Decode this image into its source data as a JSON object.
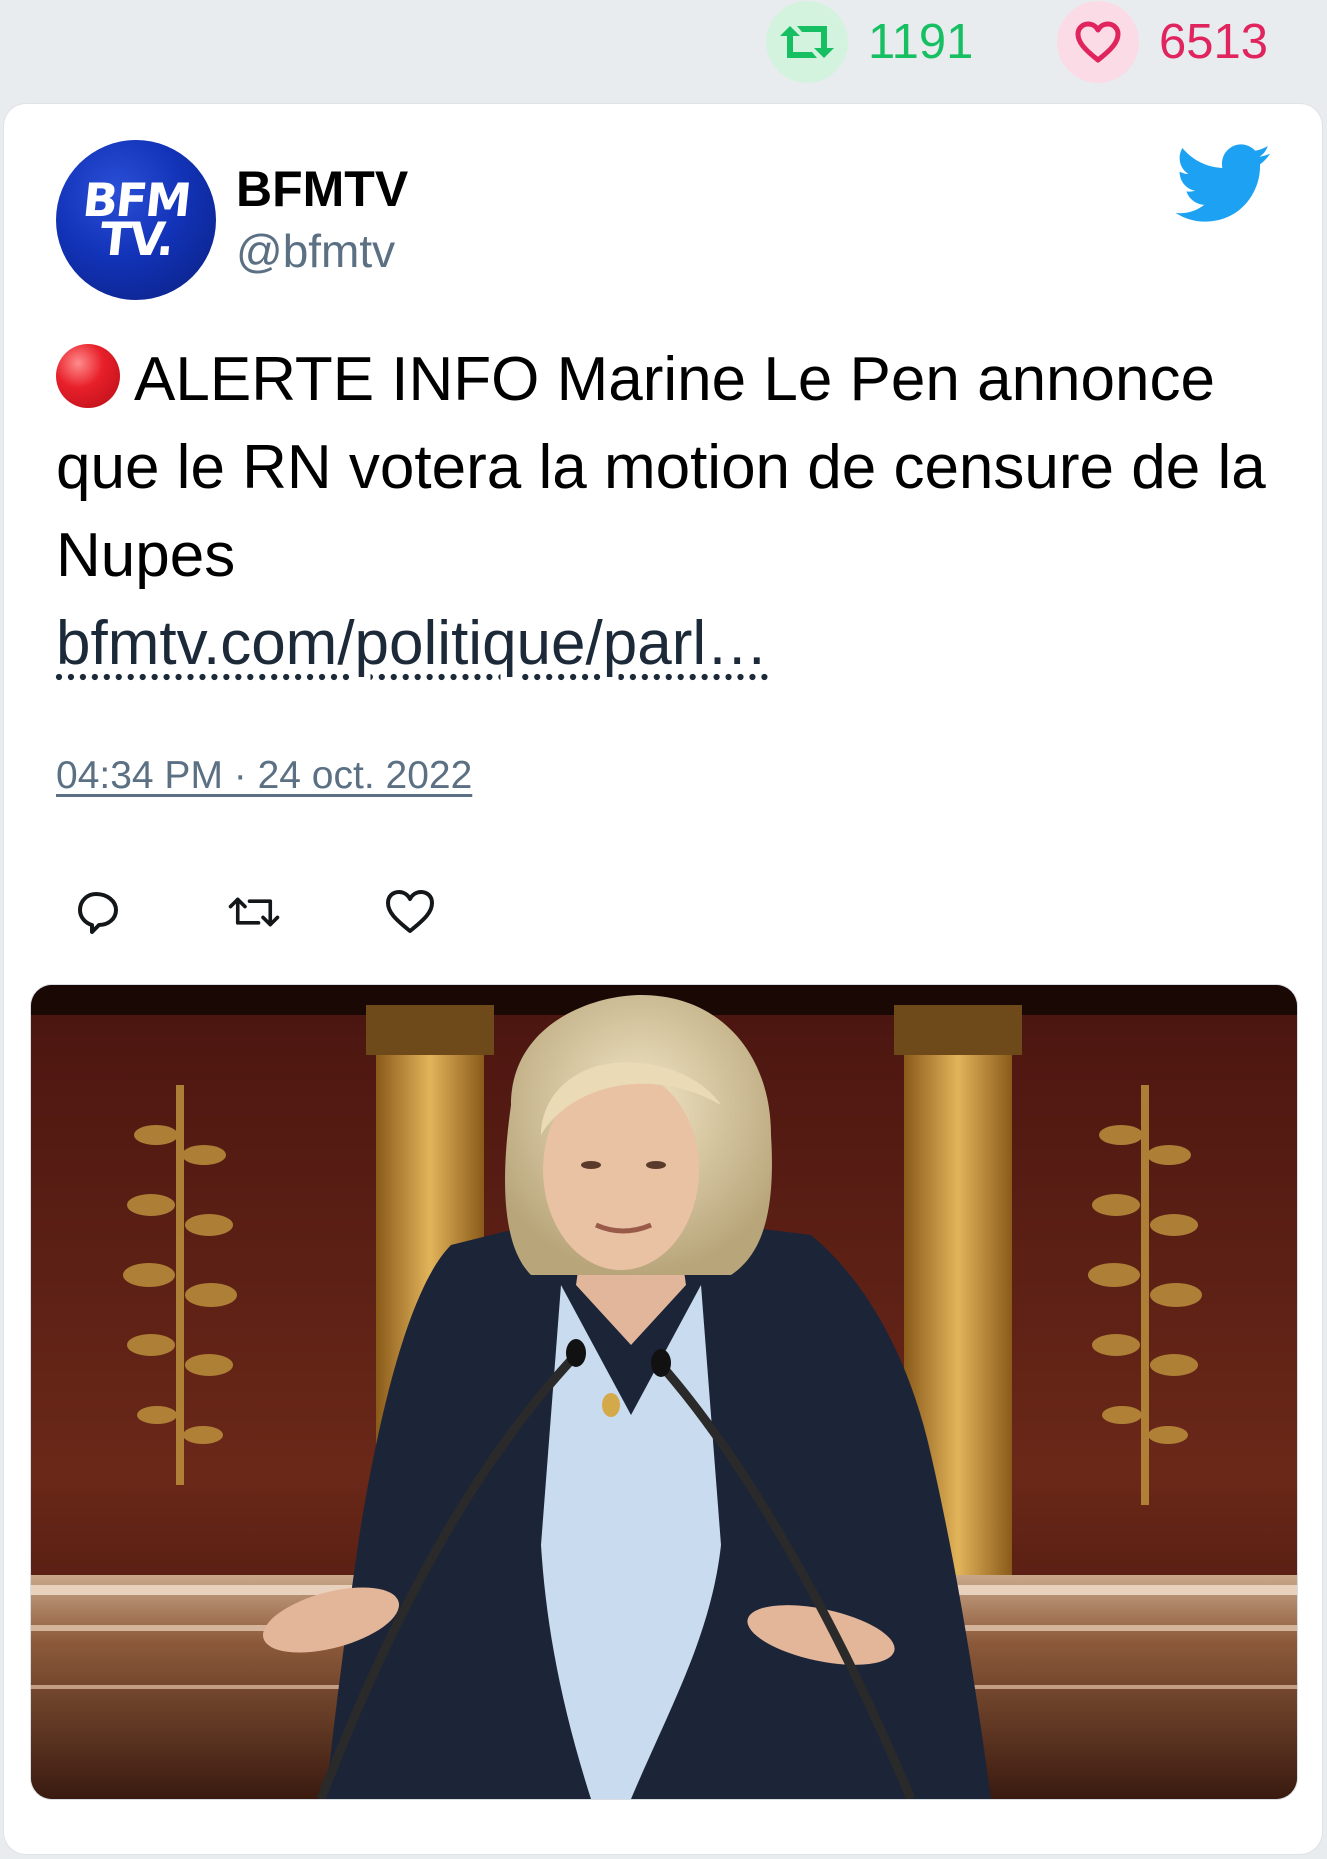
{
  "stats": {
    "retweets": "1191",
    "likes": "6513",
    "retweet_icon": "retweet-icon",
    "like_icon": "heart-icon",
    "retweet_color": "#17bf63",
    "like_color": "#e0245e"
  },
  "author": {
    "name": "BFMTV",
    "handle": "@bfmtv",
    "avatar_line1": "BFM",
    "avatar_line2": "TV."
  },
  "tweet": {
    "text": "ALERTE INFO Marine Le Pen annonce que le RN votera la motion de censure de la Nupes",
    "link": "bfmtv.com/politique/parl…",
    "timestamp": "04:34 PM · 24 oct. 2022"
  },
  "actions": {
    "reply_icon": "reply-icon",
    "retweet_icon": "retweet-icon",
    "like_icon": "heart-icon"
  },
  "colors": {
    "twitter_blue": "#1da1f2",
    "muted": "#5b7083"
  }
}
